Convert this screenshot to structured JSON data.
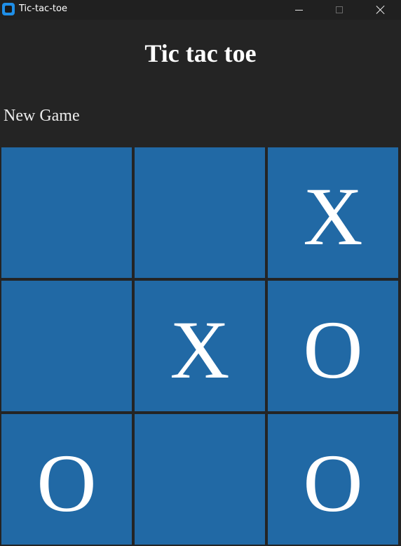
{
  "window": {
    "title": "Tic-tac-toe",
    "icon": "app-icon",
    "controls": [
      "minimize-icon",
      "maximize-icon",
      "close-icon"
    ]
  },
  "game": {
    "heading": "Tic tac toe",
    "new_game_label": "New Game"
  },
  "board": {
    "cells": [
      [
        "",
        "",
        "X"
      ],
      [
        "",
        "X",
        "O"
      ],
      [
        "O",
        "",
        "O"
      ]
    ]
  },
  "colors": {
    "background": "#242424",
    "cell": "#2169a5",
    "mark": "#ffffff",
    "app_icon": "#1f8fe8"
  }
}
